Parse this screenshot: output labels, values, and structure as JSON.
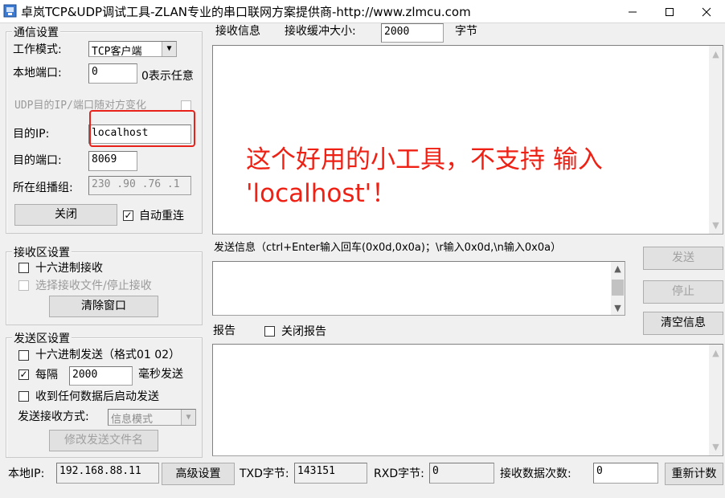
{
  "window": {
    "title": "卓岚TCP&UDP调试工具-ZLAN专业的串口联网方案提供商-http://www.zlmcu.com",
    "minimize_icon": "minimize-icon",
    "maximize_icon": "maximize-icon",
    "close_icon": "close-icon"
  },
  "comm": {
    "legend": "通信设置",
    "mode_label": "工作模式:",
    "mode_value": "TCP客户端",
    "local_port_label": "本地端口:",
    "local_port_value": "0",
    "local_port_hint": "0表示任意",
    "udp_follow_label": "UDP目的IP/端口随对方变化",
    "dest_ip_label": "目的IP:",
    "dest_ip_value": "localhost",
    "dest_port_label": "目的端口:",
    "dest_port_value": "8069",
    "multicast_label": "所在组播组:",
    "multicast_value": "230 .90 .76 .1",
    "close_button": "关闭",
    "auto_reconnect_label": "自动重连",
    "auto_reconnect_checked": "✓"
  },
  "recv_area": {
    "legend": "接收区设置",
    "hex_recv_label": "十六进制接收",
    "select_file_label": "选择接收文件/停止接收",
    "clear_button": "清除窗口"
  },
  "send_area": {
    "legend": "发送区设置",
    "hex_send_label": "十六进制发送（格式01 02）",
    "every_label": "每隔",
    "every_checked": "✓",
    "interval_value": "2000",
    "ms_label": "毫秒发送",
    "send_after_recv_label": "收到任何数据后启动发送",
    "mode_label": "发送接收方式:",
    "mode_value": "信息模式",
    "modify_file_button": "修改发送文件名"
  },
  "recv_info": {
    "label": "接收信息",
    "buffer_label": "接收缓冲大小:",
    "buffer_value": "2000",
    "unit": "字节"
  },
  "send_info": {
    "label": "发送信息（ctrl+Enter输入回车(0x0d,0x0a)；\\r输入0x0d,\\n输入0x0a）",
    "send_button": "发送",
    "stop_button": "停止",
    "clear_info_button": "清空信息"
  },
  "report": {
    "label": "报告",
    "close_report_label": "关闭报告"
  },
  "status": {
    "local_ip_label": "本地IP:",
    "local_ip_value": "192.168.88.11",
    "advanced_button": "高级设置",
    "txd_label": "TXD字节:",
    "txd_value": "143151",
    "rxd_label": "RXD字节:",
    "rxd_value": "0",
    "recv_count_label": "接收数据次数:",
    "recv_count_value": "0",
    "recount_button": "重新计数"
  },
  "annotation": {
    "line1": "这个好用的小工具，不支持 输入",
    "line2": "'localhost'！",
    "color": "#ef2014"
  }
}
